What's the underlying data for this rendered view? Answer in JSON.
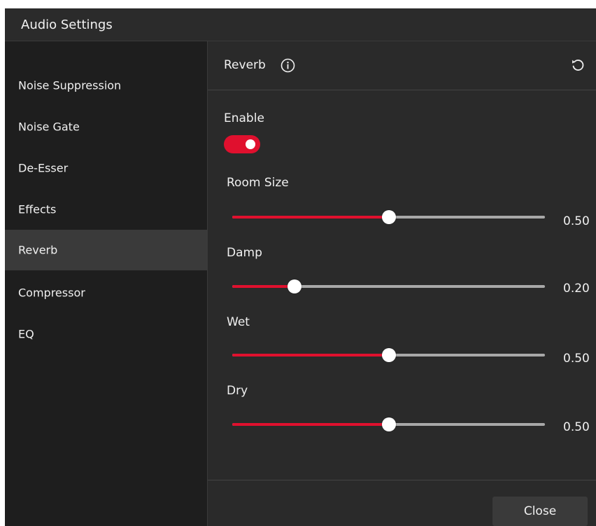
{
  "window": {
    "title": "Audio Settings"
  },
  "sidebar": {
    "items": [
      {
        "label": "Noise Suppression",
        "active": false
      },
      {
        "label": "Noise Gate",
        "active": false
      },
      {
        "label": "De-Esser",
        "active": false
      },
      {
        "label": "Effects",
        "active": false
      },
      {
        "label": "Reverb",
        "active": true
      },
      {
        "label": "Compressor",
        "active": false
      },
      {
        "label": "EQ",
        "active": false
      }
    ]
  },
  "content": {
    "title": "Reverb",
    "info_icon": "info-circle-icon",
    "reset_icon": "reset-icon",
    "enable": {
      "label": "Enable",
      "on": true
    },
    "sliders": [
      {
        "label": "Room Size",
        "value": 0.5,
        "display": "0.50"
      },
      {
        "label": "Damp",
        "value": 0.2,
        "display": "0.20"
      },
      {
        "label": "Wet",
        "value": 0.5,
        "display": "0.50"
      },
      {
        "label": "Dry",
        "value": 0.5,
        "display": "0.50"
      }
    ]
  },
  "footer": {
    "close_label": "Close"
  },
  "colors": {
    "accent": "#e0102e",
    "background": "#1e1e1e",
    "panel": "#2a2a2a",
    "selected": "#3a3a3a",
    "track": "#a8a8a8",
    "text": "#f0f0f0"
  }
}
